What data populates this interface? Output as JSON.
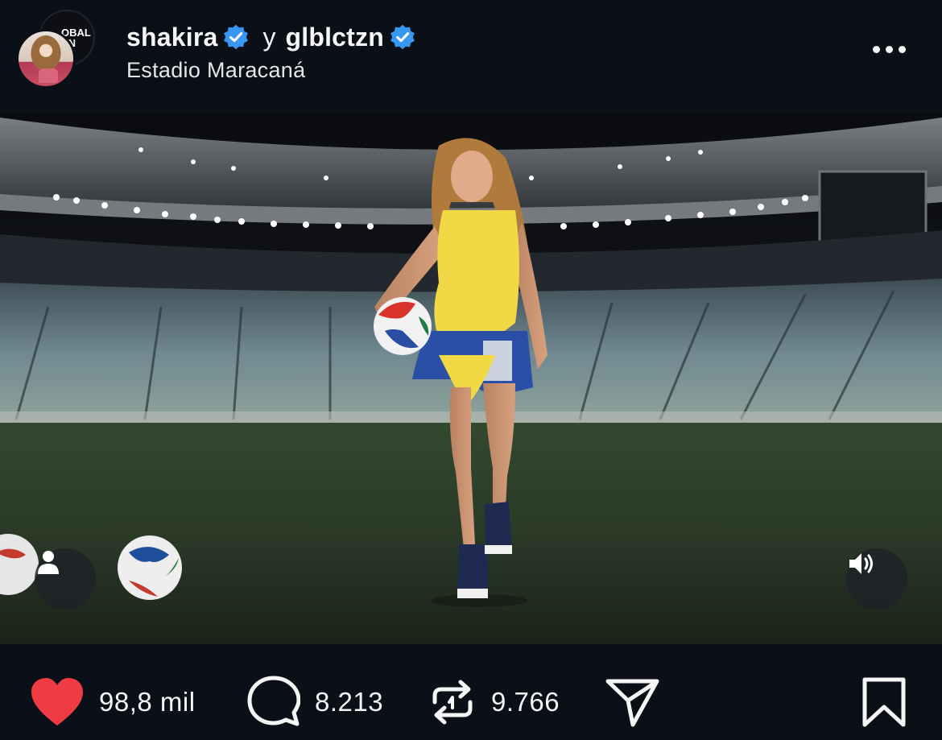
{
  "header": {
    "primary_user": "shakira",
    "joiner": "y",
    "collab_user": "glblctzn",
    "collab_badge_lines": [
      "OBAL",
      "EN"
    ],
    "location": "Estadio Maracaná"
  },
  "media": {
    "tag_icon": "person-icon",
    "sound_icon": "speaker-icon"
  },
  "actions": {
    "likes": "98,8 mil",
    "comments": "8.213",
    "reposts": "9.766"
  },
  "colors": {
    "background": "#0b0f17",
    "like_red": "#ee3b44",
    "verified_blue": "#3897f0",
    "text": "#f5f5f5"
  }
}
